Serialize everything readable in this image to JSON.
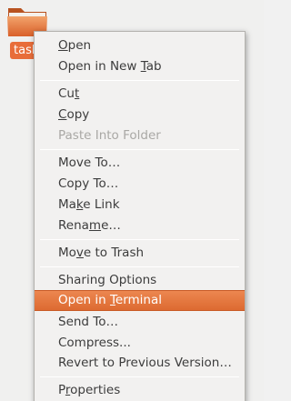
{
  "desktop": {
    "folder": {
      "label": "task",
      "icon": "folder-icon",
      "color": "#e8753a"
    }
  },
  "context_menu": {
    "accent_color": "#e2753d",
    "items": [
      {
        "key": "open",
        "label": "Open",
        "mnemonic": "O",
        "state": "normal"
      },
      {
        "key": "open-new-tab",
        "label": "Open in New Tab",
        "mnemonic": "T",
        "state": "normal"
      },
      {
        "key": "cut",
        "label": "Cut",
        "mnemonic": "t",
        "state": "normal"
      },
      {
        "key": "copy",
        "label": "Copy",
        "mnemonic": "C",
        "state": "normal"
      },
      {
        "key": "paste-into-folder",
        "label": "Paste Into Folder",
        "state": "disabled"
      },
      {
        "key": "move-to",
        "label": "Move To…",
        "state": "normal"
      },
      {
        "key": "copy-to",
        "label": "Copy To…",
        "state": "normal"
      },
      {
        "key": "make-link",
        "label": "Make Link",
        "mnemonic": "k",
        "state": "normal"
      },
      {
        "key": "rename",
        "label": "Rename…",
        "mnemonic": "m",
        "state": "normal"
      },
      {
        "key": "move-to-trash",
        "label": "Move to Trash",
        "mnemonic": "v",
        "state": "normal"
      },
      {
        "key": "sharing-options",
        "label": "Sharing Options",
        "state": "normal"
      },
      {
        "key": "open-in-terminal",
        "label": "Open in Terminal",
        "mnemonic": "T",
        "state": "highlighted"
      },
      {
        "key": "send-to",
        "label": "Send To…",
        "state": "normal"
      },
      {
        "key": "compress",
        "label": "Compress...",
        "state": "normal"
      },
      {
        "key": "revert",
        "label": "Revert to Previous Version…",
        "state": "normal"
      },
      {
        "key": "properties",
        "label": "Properties",
        "mnemonic": "r",
        "state": "normal"
      }
    ]
  }
}
